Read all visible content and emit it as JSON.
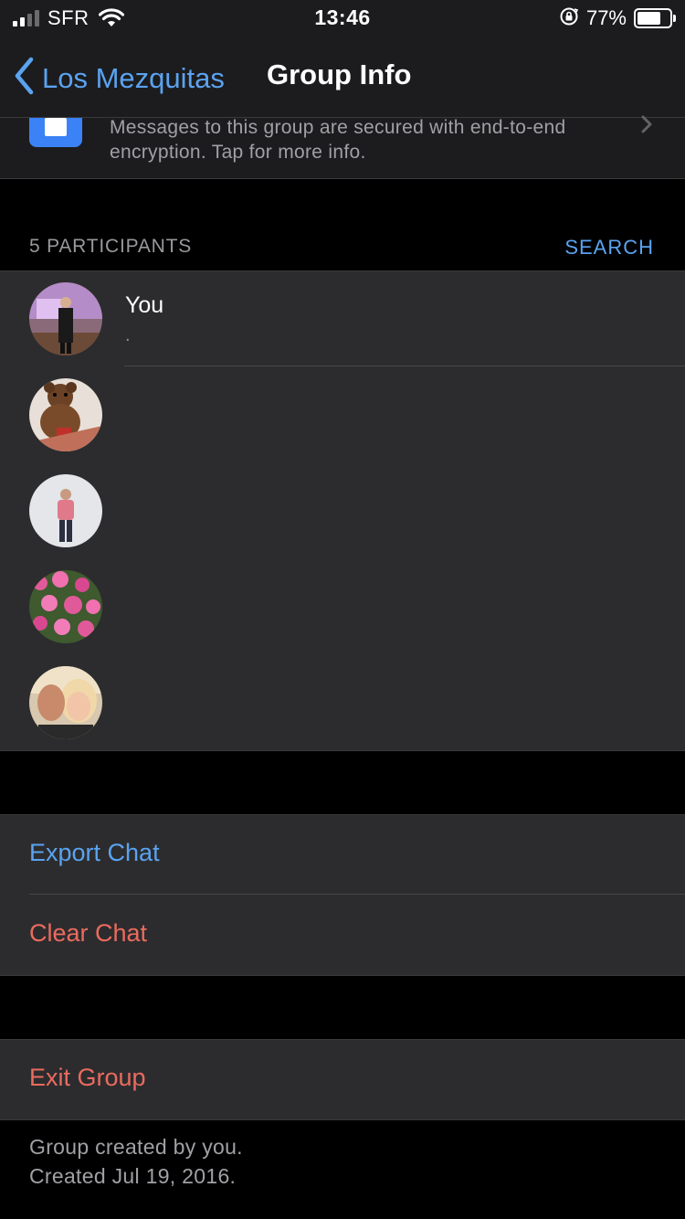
{
  "status_bar": {
    "carrier": "SFR",
    "time": "13:46",
    "battery_percent": "77%",
    "battery_level": 0.77,
    "icons": [
      "signal-icon",
      "wifi-icon",
      "orientation-lock-icon",
      "battery-icon"
    ]
  },
  "nav": {
    "back_label": "Los Mezquitas",
    "title": "Group Info"
  },
  "encryption": {
    "line1": "Messages to this group are secured with end-to-end",
    "line2": "encryption. Tap for more info."
  },
  "participants": {
    "header": "5 PARTICIPANTS",
    "search_label": "SEARCH",
    "you_name": "You",
    "you_status": "."
  },
  "actions": {
    "export": "Export Chat",
    "clear": "Clear Chat",
    "exit": "Exit Group"
  },
  "footer": {
    "line1": "Group created by you.",
    "line2": "Created Jul 19, 2016."
  },
  "colors": {
    "accent_blue": "#5aa3f0",
    "destructive_red": "#ea6b5f",
    "row_bg": "#2c2c2e"
  }
}
